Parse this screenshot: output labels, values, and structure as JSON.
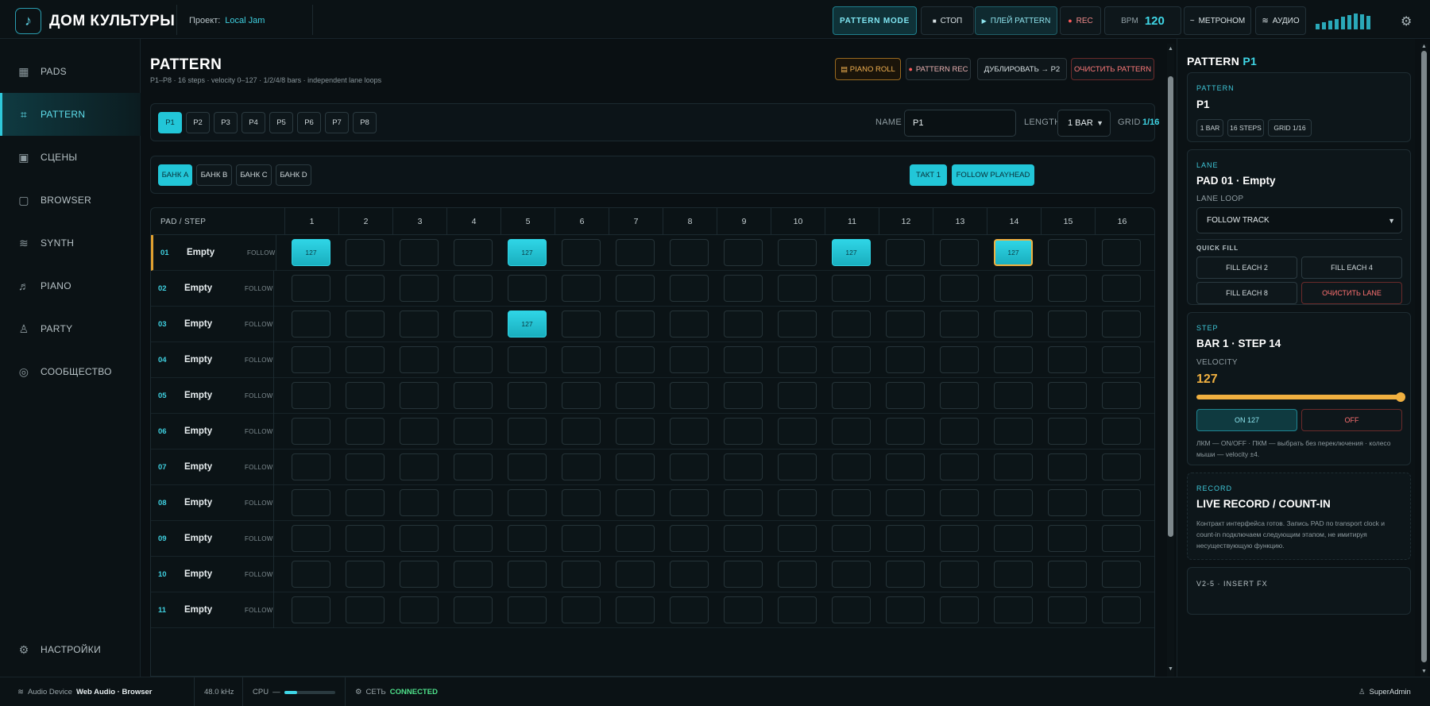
{
  "header": {
    "logo_glyph": "♪",
    "app_title": "ДОМ КУЛЬТУРЫ",
    "project_label": "Проект:",
    "project_name": "Local Jam",
    "pattern_mode": "PATTERN MODE",
    "stop": "СТОП",
    "play_pattern": "ПЛЕЙ PATTERN",
    "rec": "REC",
    "bpm_label": "BPM",
    "bpm_value": "120",
    "metronome": "МЕТРОНОМ",
    "audio": "АУДИО",
    "meter_levels": [
      0.35,
      0.45,
      0.55,
      0.65,
      0.8,
      0.9,
      1.0,
      0.95,
      0.85
    ]
  },
  "sidebar": {
    "items": [
      {
        "label": "PADS",
        "icon": "grid-icon",
        "glyph": "▦"
      },
      {
        "label": "PATTERN",
        "icon": "crop-icon",
        "glyph": "⌗"
      },
      {
        "label": "СЦЕНЫ",
        "icon": "scene-icon",
        "glyph": "▣"
      },
      {
        "label": "BROWSER",
        "icon": "folder-icon",
        "glyph": "▢"
      },
      {
        "label": "SYNTH",
        "icon": "wave-icon",
        "glyph": "≋"
      },
      {
        "label": "PIANO",
        "icon": "music-note-icon",
        "glyph": "♬"
      },
      {
        "label": "PARTY",
        "icon": "person-icon",
        "glyph": "♙"
      },
      {
        "label": "СООБЩЕСТВО",
        "icon": "community-icon",
        "glyph": "◎"
      }
    ],
    "settings": {
      "label": "НАСТРОЙКИ",
      "glyph": "⚙"
    }
  },
  "main": {
    "title": "PATTERN",
    "subtitle": "P1–P8 · 16 steps · velocity 0–127 · 1/2/4/8 bars · independent lane loops",
    "piano_roll": "▤ PIANO ROLL",
    "pattern_rec": "PATTERN REC",
    "duplicate": "ДУБЛИРОВАТЬ → P2",
    "clear_pattern": "ОЧИСТИТЬ PATTERN",
    "patterns": [
      "P1",
      "P2",
      "P3",
      "P4",
      "P5",
      "P6",
      "P7",
      "P8"
    ],
    "name_label": "NAME",
    "name_value": "P1",
    "length_label": "LENGTH",
    "length_value": "1 BAR",
    "grid_label": "GRID",
    "grid_value": "1/16",
    "banks": [
      "БАНК A",
      "БАНК B",
      "БАНК C",
      "БАНК D"
    ],
    "takt": "ТАКТ 1",
    "follow_playhead": "FOLLOW PLAYHEAD",
    "seq_header": "PAD / STEP",
    "steps": [
      "1",
      "2",
      "3",
      "4",
      "5",
      "6",
      "7",
      "8",
      "9",
      "10",
      "11",
      "12",
      "13",
      "14",
      "15",
      "16"
    ],
    "rows": [
      {
        "num": "01",
        "name": "Empty",
        "mode": "FOLLOW",
        "on": [
          1,
          5,
          11,
          14
        ],
        "vel": "127"
      },
      {
        "num": "02",
        "name": "Empty",
        "mode": "FOLLOW",
        "on": [],
        "vel": "127"
      },
      {
        "num": "03",
        "name": "Empty",
        "mode": "FOLLOW",
        "on": [
          5
        ],
        "vel": "127"
      },
      {
        "num": "04",
        "name": "Empty",
        "mode": "FOLLOW",
        "on": [],
        "vel": "127"
      },
      {
        "num": "05",
        "name": "Empty",
        "mode": "FOLLOW",
        "on": [],
        "vel": "127"
      },
      {
        "num": "06",
        "name": "Empty",
        "mode": "FOLLOW",
        "on": [],
        "vel": "127"
      },
      {
        "num": "07",
        "name": "Empty",
        "mode": "FOLLOW",
        "on": [],
        "vel": "127"
      },
      {
        "num": "08",
        "name": "Empty",
        "mode": "FOLLOW",
        "on": [],
        "vel": "127"
      },
      {
        "num": "09",
        "name": "Empty",
        "mode": "FOLLOW",
        "on": [],
        "vel": "127"
      },
      {
        "num": "10",
        "name": "Empty",
        "mode": "FOLLOW",
        "on": [],
        "vel": "127"
      },
      {
        "num": "11",
        "name": "Empty",
        "mode": "FOLLOW",
        "on": [],
        "vel": "127"
      }
    ],
    "selected_row": 0,
    "selected_step": 14
  },
  "right": {
    "title_prefix": "PATTERN",
    "title_id": "P1",
    "pattern_section": "PATTERN",
    "pattern_name": "P1",
    "pattern_pills": [
      "1 BAR",
      "16 STEPS",
      "GRID 1/16"
    ],
    "lane_section": "LANE",
    "lane_name": "PAD 01 · Empty",
    "lane_loop_label": "LANE LOOP",
    "lane_loop_value": "FOLLOW TRACK",
    "quick_fill_label": "QUICK FILL",
    "fill2": "FILL EACH 2",
    "fill4": "FILL EACH 4",
    "fill8": "FILL EACH 8",
    "clear_lane": "ОЧИСТИТЬ LANE",
    "step_section": "STEP",
    "step_name": "BAR 1 · STEP 14",
    "velocity_label": "VELOCITY",
    "velocity_value": "127",
    "velocity_fraction": 1.0,
    "on_btn": "ON 127",
    "off_btn": "OFF",
    "step_note": "ЛКМ — ON/OFF · ПКМ — выбрать без переключения · колесо мыши — velocity ±4.",
    "record_section": "RECORD",
    "record_title": "LIVE RECORD / COUNT-IN",
    "record_note": "Контракт интерфейса готов. Запись PAD по transport clock и count-in подключаем следующим этапом, не имитируя несуществующую функцию.",
    "fx_section": "V2-5 · INSERT FX"
  },
  "footer": {
    "audio_device_label": "Audio Device",
    "audio_device_value": "Web Audio · Browser",
    "sample_rate": "48.0 kHz",
    "cpu_label": "CPU",
    "cpu_dash": "—",
    "cpu_fraction": 0.25,
    "net_label": "СЕТЬ",
    "net_status": "CONNECTED",
    "user": "SuperAdmin"
  }
}
